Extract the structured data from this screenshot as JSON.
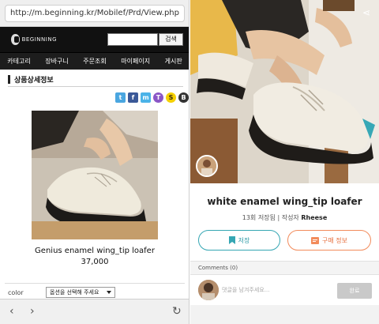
{
  "left": {
    "url": "http://m.beginning.kr/Mobilef/Prd/View.php",
    "site": {
      "logo_text": "BEGINNING",
      "search_button": "검색"
    },
    "menu": [
      "카테고리",
      "장바구니",
      "주문조회",
      "마이페이지",
      "게시판"
    ],
    "section_title": "상품상세정보",
    "share_icons": [
      "twitter-icon",
      "facebook-icon",
      "me2day-icon",
      "kakaotalk-icon",
      "kakaostory-icon",
      "band-icon"
    ],
    "share_glyphs": [
      "t",
      "f",
      "m",
      "T",
      "S",
      "B"
    ],
    "product": {
      "name": "Genius enamel wing_tip loafer",
      "price": "37,000"
    },
    "option": {
      "label": "color",
      "select_value": "옵션을 선택해 주세요"
    },
    "nav": {
      "back": "‹",
      "forward": "›",
      "reload": "↻"
    }
  },
  "right": {
    "share_glyph": "⋖",
    "item": {
      "title": "white enamel wing_tip loafer",
      "saves": "13회 저장됨",
      "author_label": "작성자",
      "author": "Rheese"
    },
    "buttons": {
      "save": "저장",
      "buy": "구매 정보"
    },
    "comments": {
      "header": "Comments (0)",
      "placeholder": "댓글을 남겨주세요...",
      "submit": "완료"
    }
  },
  "colors": {
    "save_accent": "#35a6b3",
    "buy_accent": "#f28b5b",
    "header_bg": "#111111"
  }
}
